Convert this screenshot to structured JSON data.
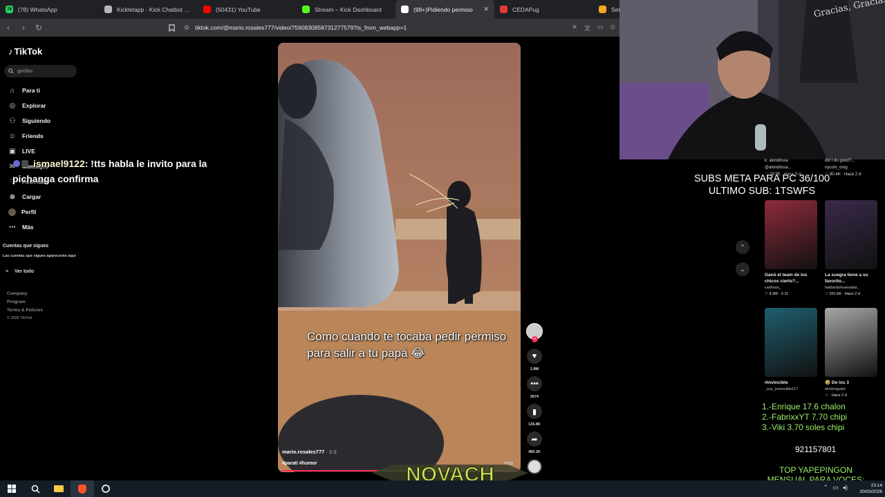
{
  "tabs": [
    {
      "title": "(78) WhatsApp",
      "icon": "whatsapp-icon",
      "color": "#25d366",
      "badge": "78"
    },
    {
      "title": "Kickletapp - Kick Chatbot and",
      "icon": "kicklet-icon",
      "color": "#b7b7b7",
      "badge": ""
    },
    {
      "title": "(50431) YouTube",
      "icon": "youtube-icon",
      "color": "#ff0000",
      "badge": ""
    },
    {
      "title": "Stream – Kick Dashboard",
      "icon": "kick-icon",
      "color": "#53fc18",
      "badge": ""
    },
    {
      "title": "(99+)Pidiendo permiso",
      "icon": "tiktok-icon",
      "color": "#ffffff",
      "badge": ""
    },
    {
      "title": "CEDAPug",
      "icon": "cedapug-icon",
      "color": "#e53935",
      "badge": ""
    },
    {
      "title": "Setti",
      "icon": "settings-icon",
      "color": "#f5a623",
      "badge": ""
    }
  ],
  "address": {
    "url": "tiktok.com/@mario.rosales777/video/7590830858731277579?is_from_webapp=1"
  },
  "tiktok": {
    "brand": "TikTok",
    "search_value": "gorillas",
    "nav": [
      {
        "label": "Para ti",
        "icon": "home-icon"
      },
      {
        "label": "Explorar",
        "icon": "compass-icon"
      },
      {
        "label": "Siguiendo",
        "icon": "following-icon"
      },
      {
        "label": "Friends",
        "icon": "friends-icon"
      },
      {
        "label": "LIVE",
        "icon": "live-icon"
      },
      {
        "label": "Mensajes",
        "icon": "messages-icon"
      },
      {
        "label": "Actividad",
        "icon": "activity-icon"
      },
      {
        "label": "Cargar",
        "icon": "upload-icon"
      },
      {
        "label": "Perfil",
        "icon": "profile-avatar"
      },
      {
        "label": "Más",
        "icon": "more-icon"
      }
    ],
    "following_title": "Cuentas que sigues",
    "following_note": "Las cuentas que sigues aparecerán aquí",
    "see_all": "Ver todo",
    "footer": [
      "Company",
      "Program",
      "Terms & Policies"
    ],
    "copyright": "© 2026 TikTok"
  },
  "chat": {
    "user": "ismael9122",
    "message": "!tts habla le invito para la pichanga confirma"
  },
  "video": {
    "caption": "Como cuando te tocaba pedir permiso para salir a tu papá 😂",
    "author": "mario.rosales777",
    "age": "· 1-2",
    "hashtags": "#parati #humor",
    "more": "más",
    "progress": 0.41
  },
  "actions": {
    "likes": "1.8M",
    "comments": "3674",
    "saves": "136.8K",
    "shares": "480.2K"
  },
  "reco": {
    "top_left": [
      "k: alondrissa",
      "@alondrissa...",
      "♡ 28.9K · Hace 3 d"
    ],
    "top_right": [
      "did I do good?...",
      "nycom_omg",
      "♡ 90.4K · Hace 2 d"
    ],
    "cards": [
      {
        "desc": "Ganó el team de los chicos cierto?...",
        "author": "carlhoos_",
        "stats": "♡ 4.3M · 2-11",
        "thumb": "#8e2b3c"
      },
      {
        "desc": "La suegra tiene a su favorito...",
        "author": "hablandohuevadas...",
        "stats": "♡ 331.6K · Hace 2 d",
        "thumb": "#3a2a4a"
      },
      {
        "desc": "#invincible",
        "author": "_soy_invencible117",
        "stats": "",
        "thumb": "#1f5f6f"
      },
      {
        "desc": "🤣 De los 3",
        "author": "elchinogutor",
        "stats": "♡ · Hace 2 d",
        "thumb": "#a7a7a7"
      }
    ]
  },
  "overlay": {
    "subs_goal": "SUBS META PARA PC 36/100",
    "last_sub": "ULTIMO SUB: 1TSWFS",
    "ranking": [
      "1.-Enrique 17.6 chalon",
      "2.-FabrixxYT 7.70 chipi",
      "3.-Viki 3.70 soles chipi"
    ],
    "phone": "921157801",
    "top_yape_1": "TOP YAPEPINGON",
    "top_yape_2": "MENSUAL PARA VOCES:",
    "brand_banner": "NOVACH",
    "webcam_shirt": "Gracias, Gracias"
  },
  "clock": {
    "time": "23:14",
    "date": "20/03/2026"
  },
  "colors": {
    "tiktok_red": "#fe2c55",
    "overlay_green": "#9ef06a",
    "chrome_dark": "#202124"
  }
}
